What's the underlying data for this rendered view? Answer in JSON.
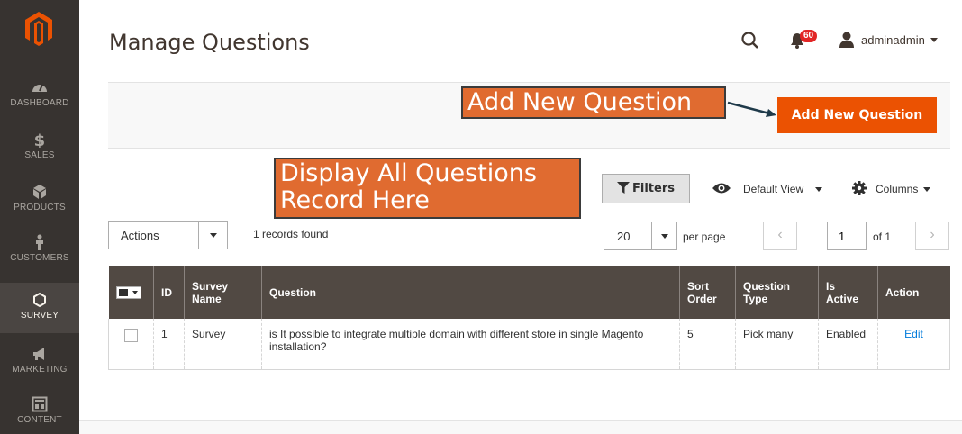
{
  "sidebar": {
    "items": [
      {
        "label": "DASHBOARD",
        "icon": "dashboard-icon"
      },
      {
        "label": "SALES",
        "icon": "dollar-icon"
      },
      {
        "label": "PRODUCTS",
        "icon": "cube-icon"
      },
      {
        "label": "CUSTOMERS",
        "icon": "person-icon"
      },
      {
        "label": "SURVEY",
        "icon": "hexagon-icon",
        "active": true
      },
      {
        "label": "MARKETING",
        "icon": "megaphone-icon"
      },
      {
        "label": "CONTENT",
        "icon": "layout-icon"
      }
    ]
  },
  "header": {
    "title": "Manage Questions",
    "notification_count": "60",
    "username": "adminadmin"
  },
  "action_bar": {
    "add_button": "Add New Question"
  },
  "annotations": {
    "add": "Add New Question",
    "display_line1": "Display All Questions",
    "display_line2": "Record Here"
  },
  "toolbar": {
    "filters": "Filters",
    "view": "Default View",
    "columns": "Columns",
    "actions": "Actions",
    "records_found": "1 records found",
    "per_page_value": "20",
    "per_page_label": "per page",
    "page_value": "1",
    "page_of": "of 1",
    "prev_glyph": "‹",
    "next_glyph": "›"
  },
  "table": {
    "headers": {
      "id": "ID",
      "survey_name_1": "Survey",
      "survey_name_2": "Name",
      "question": "Question",
      "sort_order_1": "Sort",
      "sort_order_2": "Order",
      "question_type_1": "Question",
      "question_type_2": "Type",
      "is_active_1": "Is",
      "is_active_2": "Active",
      "action": "Action"
    },
    "rows": [
      {
        "id": "1",
        "survey_name": "Survey",
        "question": "is It possible to integrate multiple domain with different store in single Magento installation?",
        "sort_order": "5",
        "question_type": "Pick many",
        "is_active": "Enabled",
        "action": "Edit"
      }
    ]
  },
  "colors": {
    "sidebar_bg": "#373330",
    "primary_button": "#eb5202",
    "table_header": "#514943",
    "annotation": "#e06b30",
    "link": "#007bdb",
    "badge": "#e22626"
  }
}
